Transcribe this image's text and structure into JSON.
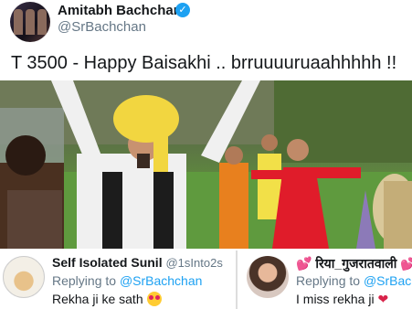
{
  "tweet": {
    "display_name": "Amitabh Bachchan",
    "handle": "@SrBachchan",
    "verified_icon": "verified-badge-icon",
    "text": "T 3500 - Happy Baisakhi .. brruuuuruaahhhhh !!",
    "media_icon": "dance-scene-photo"
  },
  "replies": [
    {
      "name": "Self Isolated Sunil",
      "handle": "@1sInto2s",
      "replying_prefix": "Replying to",
      "replying_mention": "@SrBachchan",
      "text": "Rekha ji ke sath",
      "emoji_icon": "heart-eyes-emoji-icon"
    },
    {
      "name": "रिया_गुजरातवाली",
      "name_icon": "hearts-icon",
      "replying_prefix": "Replying to",
      "replying_mention": "@SrBac",
      "text": "I miss rekha ji",
      "emoji_icon": "heart-icon"
    }
  ],
  "colors": {
    "accent": "#1da1f2",
    "heart": "#d8234a",
    "muted": "#657786"
  }
}
